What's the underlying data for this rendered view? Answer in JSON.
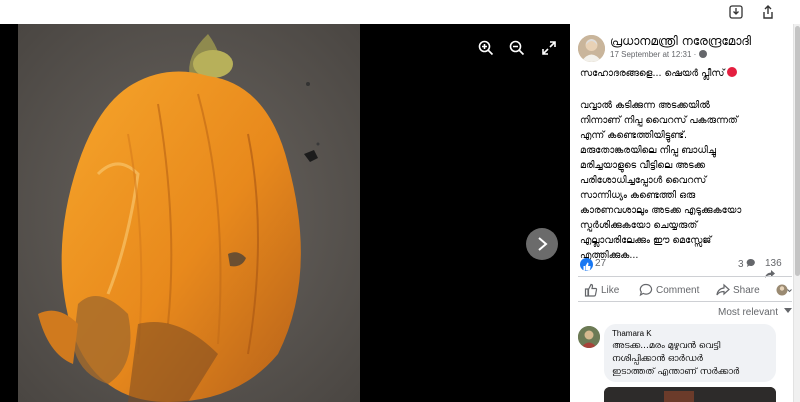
{
  "viewer": {
    "zoom_in_icon": "zoom-in-icon",
    "zoom_out_icon": "zoom-out-icon",
    "fullscreen_icon": "expand-icon",
    "next_icon": "chevron-right-icon"
  },
  "post": {
    "author": "പ്രധാനമന്ത്രി നരേന്ദ്രമോദി",
    "timestamp": "17 September at 12:31 · ",
    "greeting": "സഹോദരങ്ങളെ... ഷെയർ പ്ലീസ്",
    "body_lines": [
      "വവ്വാൽ കടിക്കുന്ന അടക്കയിൽ",
      "നിന്നാണ് നിപ്പ വൈറസ് പകരുന്നത്",
      "എന്ന് കണ്ടെത്തിയിട്ടുണ്ട്.",
      "മരുതോങ്കരയിലെ നിപ്പ ബാധിച്ചു",
      "മരിച്ചയാളുടെ വീട്ടിലെ അടക്ക",
      "പരിശോധിച്ചപ്പോൾ വൈറസ്",
      "സാന്നിധ്യം കണ്ടെത്തി ഒരു",
      "കാരണവശാലും അടക്ക എടുക്കുകയോ",
      "സ്പർശിക്കുകയോ ചെയ്യരുത്",
      "എല്ലാവരിലേക്കും ഈ മെസ്സേജ്",
      "എത്തിക്കുക..."
    ],
    "like_count": "27",
    "comment_count": "3",
    "share_count": "136"
  },
  "actions": {
    "like": "Like",
    "comment": "Comment",
    "share": "Share"
  },
  "comments": {
    "sort_label": "Most relevant",
    "items": [
      {
        "author": "Thamara K",
        "lines": [
          "അടക്ക...മരം മുഴുവൻ വെട്ടി",
          "നശിപ്പിക്കാൻ ഓർഡർ",
          "ഇടാത്തത് എന്താണ് സർക്കാർ"
        ]
      }
    ]
  },
  "colors": {
    "accent": "#1877f2",
    "viewer_bg": "#000000",
    "text": "#050505",
    "muted": "#65676b",
    "fruit": "#e8891c"
  }
}
